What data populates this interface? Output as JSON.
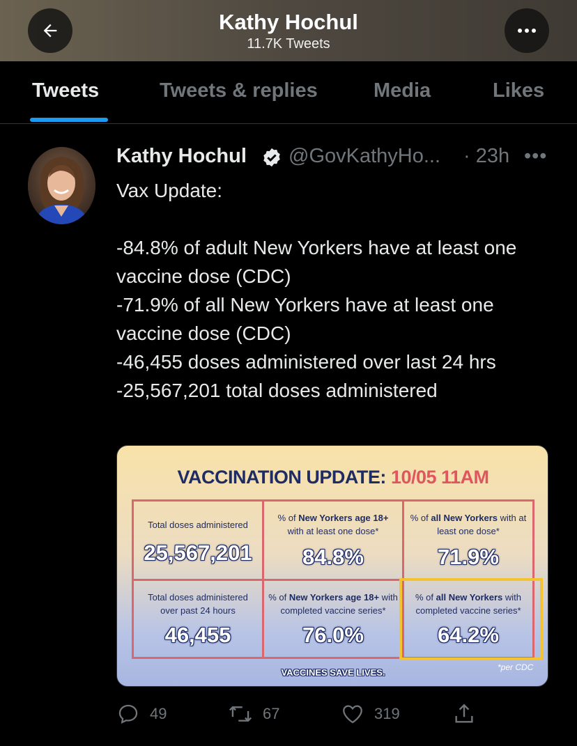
{
  "header": {
    "title": "Kathy Hochul",
    "subtitle": "11.7K Tweets"
  },
  "tabs": [
    {
      "label": "Tweets",
      "active": true
    },
    {
      "label": "Tweets & replies",
      "active": false
    },
    {
      "label": "Media",
      "active": false
    },
    {
      "label": "Likes",
      "active": false
    }
  ],
  "tweet": {
    "author": "Kathy Hochul",
    "handle": "@GovKathyHo...",
    "time": "· 23h",
    "more": "•••",
    "text": "Vax Update:\n\n-84.8% of adult New Yorkers have at least one vaccine dose (CDC)\n-71.9% of all New Yorkers have at least one vaccine dose (CDC)\n-46,455 doses administered over last 24 hrs\n-25,567,201 total doses administered",
    "image": {
      "title_main": "VACCINATION UPDATE:",
      "title_date": "10/05 11AM",
      "cells": [
        {
          "label_pre": "Total doses administered",
          "label_bold": "",
          "label_post": "",
          "value": "25,567,201"
        },
        {
          "label_pre": "% of ",
          "label_bold": "New Yorkers age 18+",
          "label_post": " with at least one dose*",
          "value": "84.8%"
        },
        {
          "label_pre": "% of ",
          "label_bold": "all New Yorkers",
          "label_post": " with at least one dose*",
          "value": "71.9%"
        },
        {
          "label_pre": "Total doses administered over past 24 hours",
          "label_bold": "",
          "label_post": "",
          "value": "46,455"
        },
        {
          "label_pre": "% of ",
          "label_bold": "New Yorkers age 18+",
          "label_post": " with completed vaccine series*",
          "value": "76.0%"
        },
        {
          "label_pre": "% of ",
          "label_bold": "all New Yorkers",
          "label_post": " with completed vaccine series*",
          "value": "64.2%"
        }
      ],
      "footer": "VACCINES SAVE LIVES.",
      "note": "*per CDC"
    },
    "actions": {
      "replies": "49",
      "retweets": "67",
      "likes": "319"
    }
  },
  "colors": {
    "accent": "#1d9bf0",
    "muted": "#71767b",
    "navy": "#1f2c64",
    "red": "#e0565f",
    "highlight": "#f4c430"
  }
}
